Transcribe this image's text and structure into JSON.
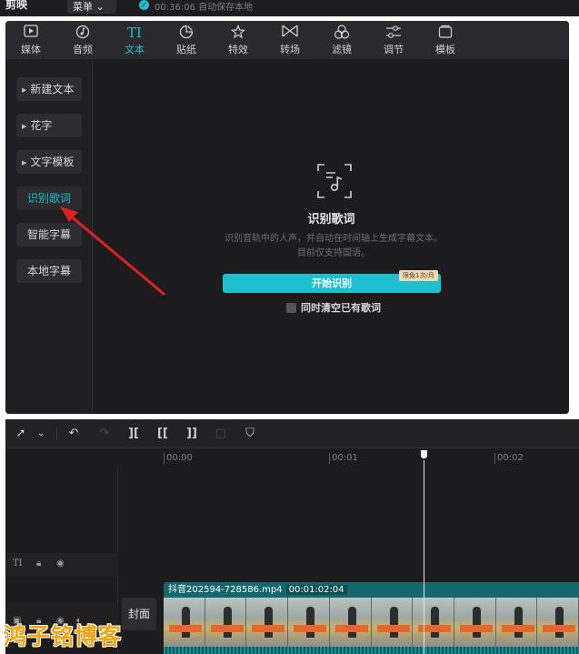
{
  "titlebar": {
    "app_name": "剪映",
    "menu_label": "菜单",
    "save_status": "00:36:06 自动保存本地"
  },
  "toolbar": {
    "tools": [
      {
        "label": "媒体",
        "icon": "media-icon"
      },
      {
        "label": "音频",
        "icon": "audio-icon"
      },
      {
        "label": "文本",
        "icon": "text-icon",
        "active": true
      },
      {
        "label": "贴纸",
        "icon": "sticker-icon"
      },
      {
        "label": "特效",
        "icon": "effects-icon"
      },
      {
        "label": "转场",
        "icon": "transition-icon"
      },
      {
        "label": "滤镜",
        "icon": "filter-icon"
      },
      {
        "label": "调节",
        "icon": "adjust-icon"
      },
      {
        "label": "模板",
        "icon": "template-icon"
      }
    ],
    "active_color": "#1ec0cf"
  },
  "sidebar": {
    "items": [
      {
        "label": "新建文本"
      },
      {
        "label": "花字"
      },
      {
        "label": "文字模板"
      },
      {
        "label": "识别歌词",
        "active": true
      },
      {
        "label": "智能字幕"
      },
      {
        "label": "本地字幕"
      }
    ]
  },
  "content": {
    "title": "识别歌词",
    "description": "识别音轨中的人声，并自动在时间轴上生成字幕文本。目前仅支持国语。",
    "start_button": "开始识别",
    "free_badge": "限免1次/月",
    "clear_checkbox_label": "同时清空已有歌词",
    "clear_checked": false
  },
  "timeline": {
    "ruler_ticks": [
      "00:00",
      "00:01",
      "00:02"
    ],
    "clip_name": "抖音202594-728586.mp4",
    "clip_duration": "00:01:02:04",
    "cover_label": "封面",
    "text_track_label": "TI"
  },
  "watermark": "鸿子铭博客",
  "colors": {
    "accent": "#1ec0cf",
    "arrow": "#e02020",
    "watermark": "#f2a40c"
  }
}
